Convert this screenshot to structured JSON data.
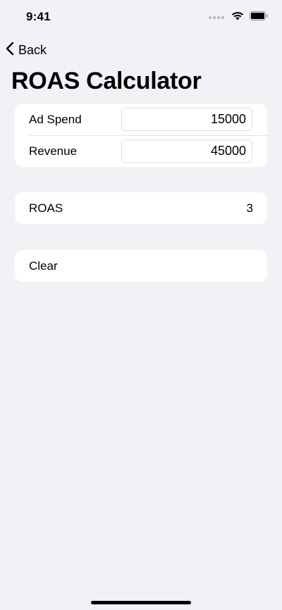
{
  "status_bar": {
    "time": "9:41"
  },
  "nav": {
    "back_label": "Back"
  },
  "page": {
    "title": "ROAS Calculator"
  },
  "inputs": [
    {
      "label": "Ad Spend",
      "value": "15000"
    },
    {
      "label": "Revenue",
      "value": "45000"
    }
  ],
  "result": {
    "label": "ROAS",
    "value": "3"
  },
  "actions": {
    "clear_label": "Clear"
  },
  "colors": {
    "background": "#f2f1f6",
    "card": "#ffffff",
    "text": "#000000"
  }
}
